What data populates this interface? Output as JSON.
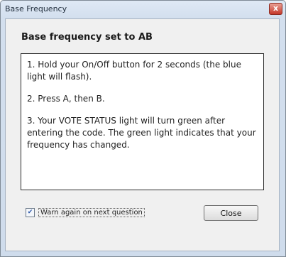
{
  "window": {
    "title": "Base Frequency",
    "close_glyph": "x"
  },
  "dialog": {
    "heading": "Base frequency set to AB",
    "steps": [
      "1. Hold your On/Off button for 2 seconds (the blue light will flash).",
      "2. Press A, then B.",
      "3. Your VOTE STATUS light will turn green after entering the code. The green light indicates that your frequency has changed."
    ],
    "warn_checkbox": {
      "label": "Warn again on next question",
      "checked": true,
      "check_glyph": "✔"
    },
    "close_label": "Close"
  }
}
